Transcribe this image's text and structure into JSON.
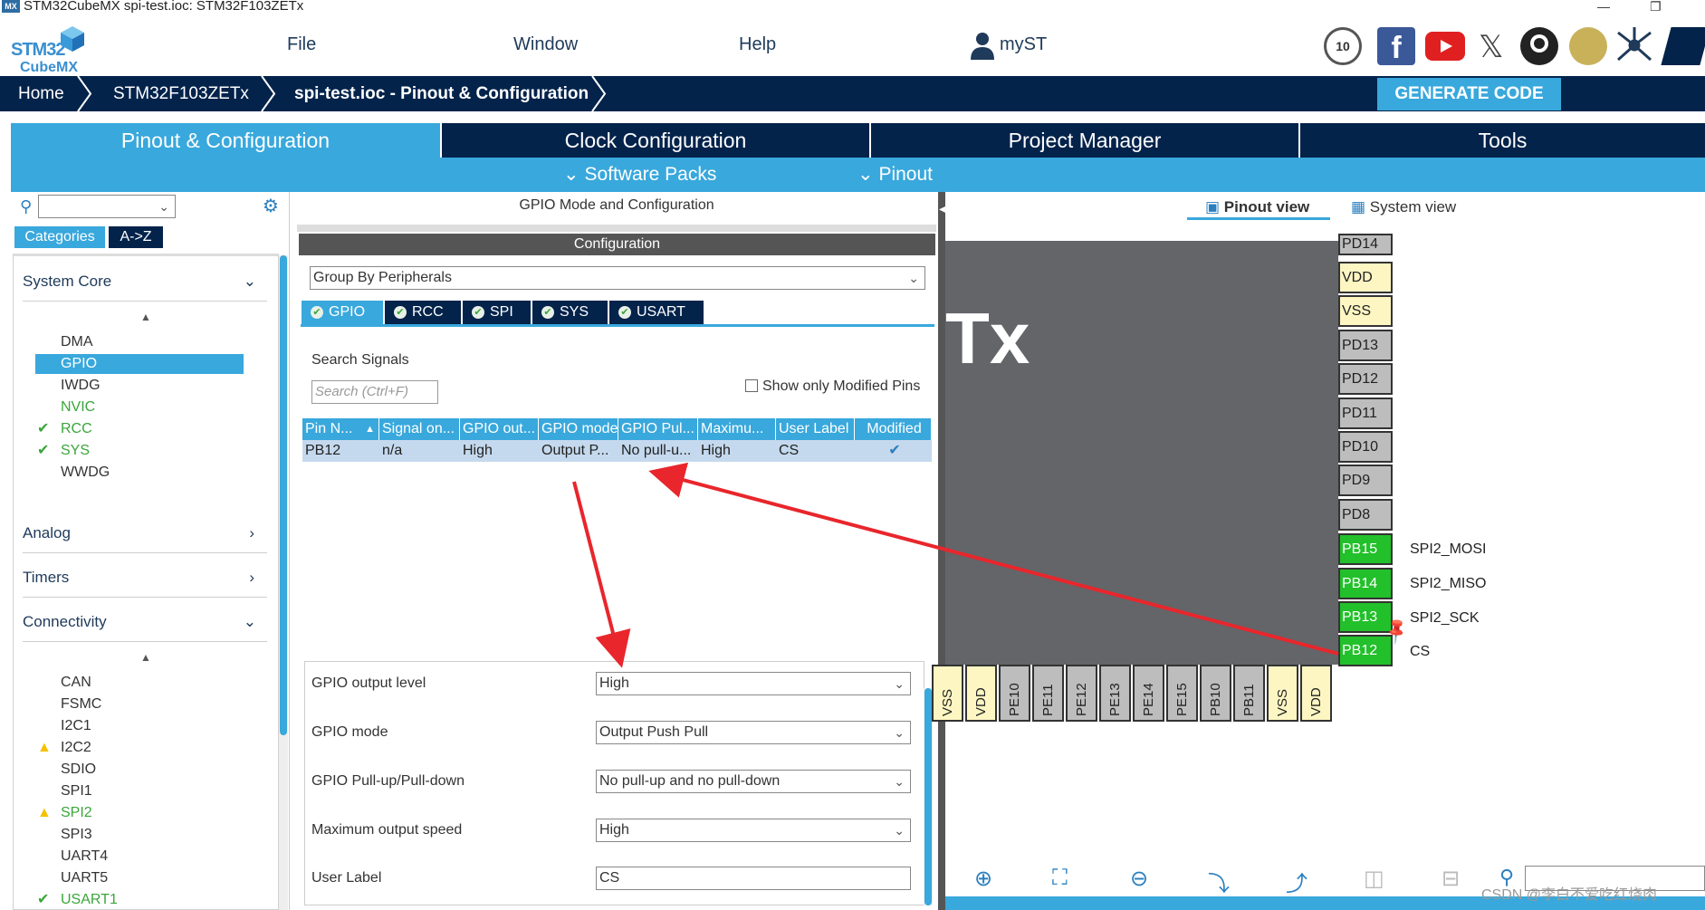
{
  "window": {
    "title": "STM32CubeMX spi-test.ioc: STM32F103ZETx",
    "badge": "MX"
  },
  "header": {
    "logo_line1": "STM32",
    "logo_line2": "CubeMX",
    "menu": [
      "File",
      "Window",
      "Help"
    ],
    "user": "myST"
  },
  "breadcrumb": [
    "Home",
    "STM32F103ZETx",
    "spi-test.ioc - Pinout & Configuration"
  ],
  "generate_label": "GENERATE CODE",
  "tabs": [
    "Pinout & Configuration",
    "Clock Configuration",
    "Project Manager",
    "Tools"
  ],
  "subtabs": [
    "Software Packs",
    "Pinout"
  ],
  "left": {
    "category_tabs": [
      "Categories",
      "A->Z"
    ],
    "sections": {
      "system_core": "System Core",
      "analog": "Analog",
      "timers": "Timers",
      "connectivity": "Connectivity"
    },
    "system_core_items": [
      "DMA",
      "GPIO",
      "IWDG",
      "NVIC",
      "RCC",
      "SYS",
      "WWDG"
    ],
    "connectivity_items": [
      "CAN",
      "FSMC",
      "I2C1",
      "I2C2",
      "SDIO",
      "SPI1",
      "SPI2",
      "SPI3",
      "UART4",
      "UART5",
      "USART1"
    ]
  },
  "middle": {
    "title": "GPIO Mode and Configuration",
    "config_header": "Configuration",
    "group_by": "Group By Peripherals",
    "periph_tabs": [
      "GPIO",
      "RCC",
      "SPI",
      "SYS",
      "USART"
    ],
    "search_label": "Search Signals",
    "search_placeholder": "Search (Ctrl+F)",
    "show_modified": "Show only Modified Pins",
    "columns": [
      "Pin N...",
      "Signal on...",
      "GPIO out...",
      "GPIO mode",
      "GPIO Pul...",
      "Maximu...",
      "User Label",
      "Modified"
    ],
    "row": [
      "PB12",
      "n/a",
      "High",
      "Output P...",
      "No pull-u...",
      "High",
      "CS",
      "✔"
    ],
    "fields": [
      {
        "label": "GPIO output level",
        "value": "High"
      },
      {
        "label": "GPIO mode",
        "value": "Output Push Pull"
      },
      {
        "label": "GPIO Pull-up/Pull-down",
        "value": "No pull-up and no pull-down"
      },
      {
        "label": "Maximum output speed",
        "value": "High"
      },
      {
        "label": "User Label",
        "value": "CS"
      }
    ]
  },
  "right": {
    "view_tabs": [
      "Pinout view",
      "System view"
    ],
    "chip_text": "Tx",
    "right_pins": [
      "PD14",
      "VDD",
      "VSS",
      "PD13",
      "PD12",
      "PD11",
      "PD10",
      "PD9",
      "PD8",
      "PB15",
      "PB14",
      "PB13",
      "PB12"
    ],
    "signals": [
      "SPI2_MOSI",
      "SPI2_MISO",
      "SPI2_SCK",
      "CS"
    ],
    "bottom_pins": [
      "VSS",
      "VDD",
      "PE10",
      "PE11",
      "PE12",
      "PE13",
      "PE14",
      "PE15",
      "PB10",
      "PB11",
      "VSS",
      "VDD"
    ]
  },
  "watermark": "CSDN @李白不爱吃红烧肉",
  "colors": {
    "accent": "#39a8dc",
    "navy": "#03234b",
    "pin_green": "#22c02a",
    "success": "#3aa63a",
    "warning": "#f5c000"
  }
}
